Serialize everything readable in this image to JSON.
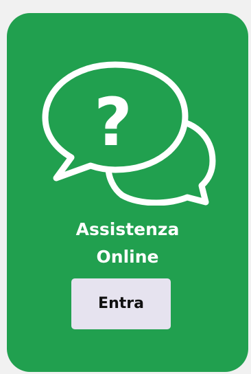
{
  "card": {
    "background_color": "#21a04f",
    "icon": "chat-bubbles-question-icon",
    "title_line1": "Assistenza",
    "title_line2": "Online",
    "button_label": "Entra",
    "button_color": "#e6e3ef"
  }
}
